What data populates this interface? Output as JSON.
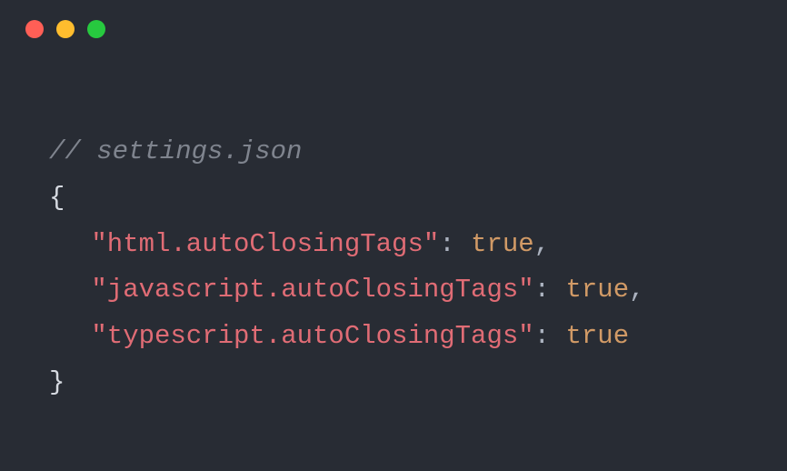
{
  "titlebar": {
    "close": "close",
    "minimize": "minimize",
    "zoom": "zoom"
  },
  "editor": {
    "comment": "// settings.json",
    "open_brace": "{",
    "close_brace": "}",
    "entries": [
      {
        "key": "\"html.autoClosingTags\"",
        "value": "true",
        "comma": ","
      },
      {
        "key": "\"javascript.autoClosingTags\"",
        "value": "true",
        "comma": ","
      },
      {
        "key": "\"typescript.autoClosingTags\"",
        "value": "true",
        "comma": ""
      }
    ]
  }
}
